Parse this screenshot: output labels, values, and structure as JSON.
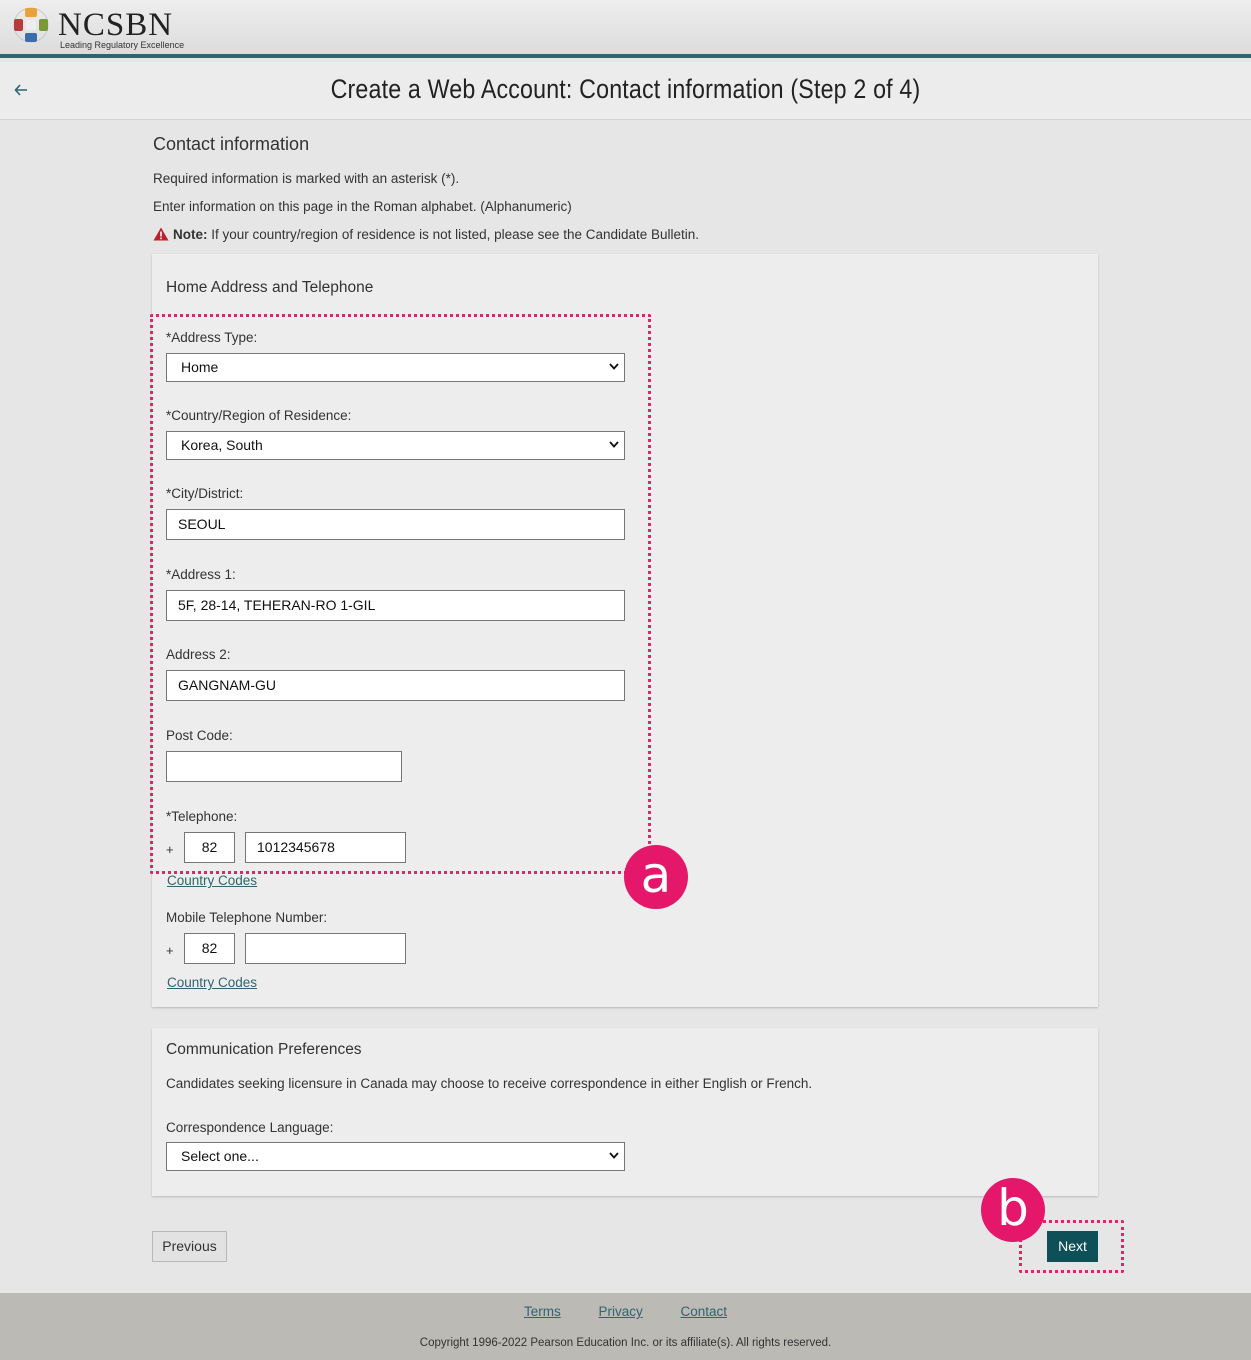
{
  "header": {
    "logo_name": "NCSBN",
    "logo_tagline": "Leading Regulatory Excellence",
    "page_title": "Create a Web Account: Contact information (Step 2 of 4)"
  },
  "intro": {
    "heading": "Contact information",
    "required_text": "Required information is marked with an asterisk (*).",
    "roman_text": "Enter information on this page in the Roman alphabet. (Alphanumeric)",
    "note_label": "Note:",
    "note_text": " If your country/region of residence is not listed, please see the Candidate Bulletin."
  },
  "home_address": {
    "title": "Home Address and Telephone",
    "address_type_label": "*Address Type:",
    "address_type_value": "Home",
    "country_label": "*Country/Region of Residence:",
    "country_value": "Korea, South",
    "city_label": "*City/District:",
    "city_value": "SEOUL",
    "address1_label": "*Address 1:",
    "address1_value": "5F, 28-14, TEHERAN-RO 1-GIL",
    "address2_label": "Address 2:",
    "address2_value": "GANGNAM-GU",
    "postcode_label": "Post Code:",
    "postcode_value": "",
    "telephone_label": "*Telephone:",
    "plus": "+",
    "telephone_code": "82",
    "telephone_number": "1012345678",
    "country_codes_link": "Country Codes",
    "mobile_label": "Mobile Telephone Number:",
    "mobile_code": "82",
    "mobile_number": ""
  },
  "communication": {
    "title": "Communication Preferences",
    "description": "Candidates seeking licensure in Canada may choose to receive correspondence in either English or French.",
    "language_label": "Correspondence Language:",
    "language_value": "Select one..."
  },
  "buttons": {
    "previous": "Previous",
    "next": "Next"
  },
  "annotations": {
    "a": "a",
    "b": "b",
    "color": "#e4176a"
  },
  "footer": {
    "terms": "Terms",
    "privacy": "Privacy",
    "contact": "Contact",
    "copyright": "Copyright 1996-2022 Pearson Education Inc. or its affiliate(s). All rights reserved."
  },
  "colors": {
    "accent": "#2f6470",
    "next_button": "#0f4f57",
    "footer_bg": "#bcbab4"
  }
}
